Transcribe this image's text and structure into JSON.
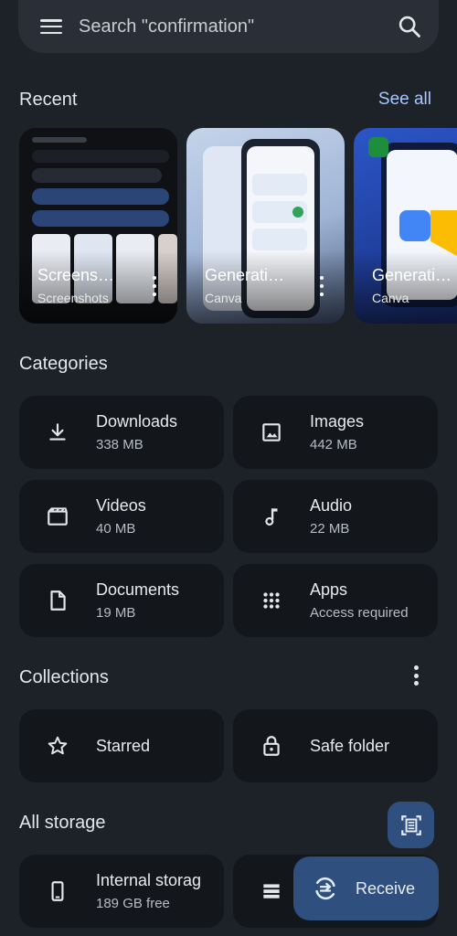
{
  "search": {
    "placeholder_text": "Search \"confirmation\""
  },
  "recent": {
    "title": "Recent",
    "see_all": "See all",
    "items": [
      {
        "title": "Screens…",
        "source": "Screenshots"
      },
      {
        "title": "Generati…",
        "source": "Canva"
      },
      {
        "title": "Generati…",
        "source": "Canva"
      }
    ]
  },
  "categories": {
    "title": "Categories",
    "items": [
      {
        "label": "Downloads",
        "detail": "338 MB",
        "icon": "download-icon"
      },
      {
        "label": "Images",
        "detail": "442 MB",
        "icon": "image-icon"
      },
      {
        "label": "Videos",
        "detail": "40 MB",
        "icon": "video-icon"
      },
      {
        "label": "Audio",
        "detail": "22 MB",
        "icon": "music-note-icon"
      },
      {
        "label": "Documents",
        "detail": "19 MB",
        "icon": "document-icon"
      },
      {
        "label": "Apps",
        "detail": "Access required",
        "icon": "apps-grid-icon"
      }
    ]
  },
  "collections": {
    "title": "Collections",
    "items": [
      {
        "label": "Starred",
        "icon": "star-icon"
      },
      {
        "label": "Safe folder",
        "icon": "lock-icon"
      }
    ]
  },
  "storage": {
    "title": "All storage",
    "items": [
      {
        "label": "Internal storag",
        "detail": "189 GB free",
        "icon": "phone-icon"
      }
    ]
  },
  "fab": {
    "receive_label": "Receive"
  },
  "colors": {
    "background": "#1d2128",
    "card": "#13161b",
    "accent": "#a9c7ff",
    "fab": "#2f4f7e"
  }
}
